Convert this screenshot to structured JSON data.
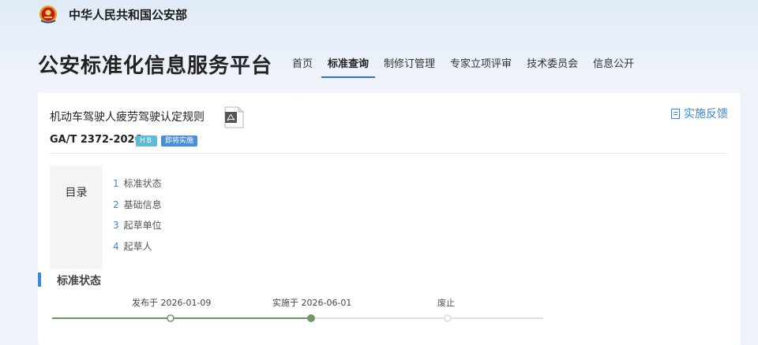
{
  "header": {
    "ministry": "中华人民共和国公安部",
    "platform_title": "公安标准化信息服务平台",
    "nav": [
      {
        "label": "首页",
        "active": false
      },
      {
        "label": "标准查询",
        "active": true
      },
      {
        "label": "制修订管理",
        "active": false
      },
      {
        "label": "专家立项评审",
        "active": false
      },
      {
        "label": "技术委员会",
        "active": false
      },
      {
        "label": "信息公开",
        "active": false
      }
    ]
  },
  "standard": {
    "title": "机动车驾驶人疲劳驾驶认定规则",
    "code": "GA/T 2372-2026",
    "badges": [
      "HB",
      "即将实施"
    ],
    "feedback_label": "实施反馈"
  },
  "toc": {
    "label": "目录",
    "items": [
      {
        "num": "1",
        "label": "标准状态"
      },
      {
        "num": "2",
        "label": "基础信息"
      },
      {
        "num": "3",
        "label": "起草单位"
      },
      {
        "num": "4",
        "label": "起草人"
      }
    ]
  },
  "status_section": {
    "title": "标准状态",
    "timeline": [
      {
        "label": "发布于 2026-01-09",
        "state": "done"
      },
      {
        "label": "实施于 2026-06-01",
        "state": "current"
      },
      {
        "label": "废止",
        "state": "pending"
      }
    ]
  },
  "colors": {
    "accent": "#3b87d8",
    "timeline_done": "#6f9a63",
    "timeline_pending": "#d9d9d9"
  },
  "icons": {
    "emblem": "police-emblem-icon",
    "pdf": "pdf-file-icon",
    "feedback": "document-list-icon"
  }
}
